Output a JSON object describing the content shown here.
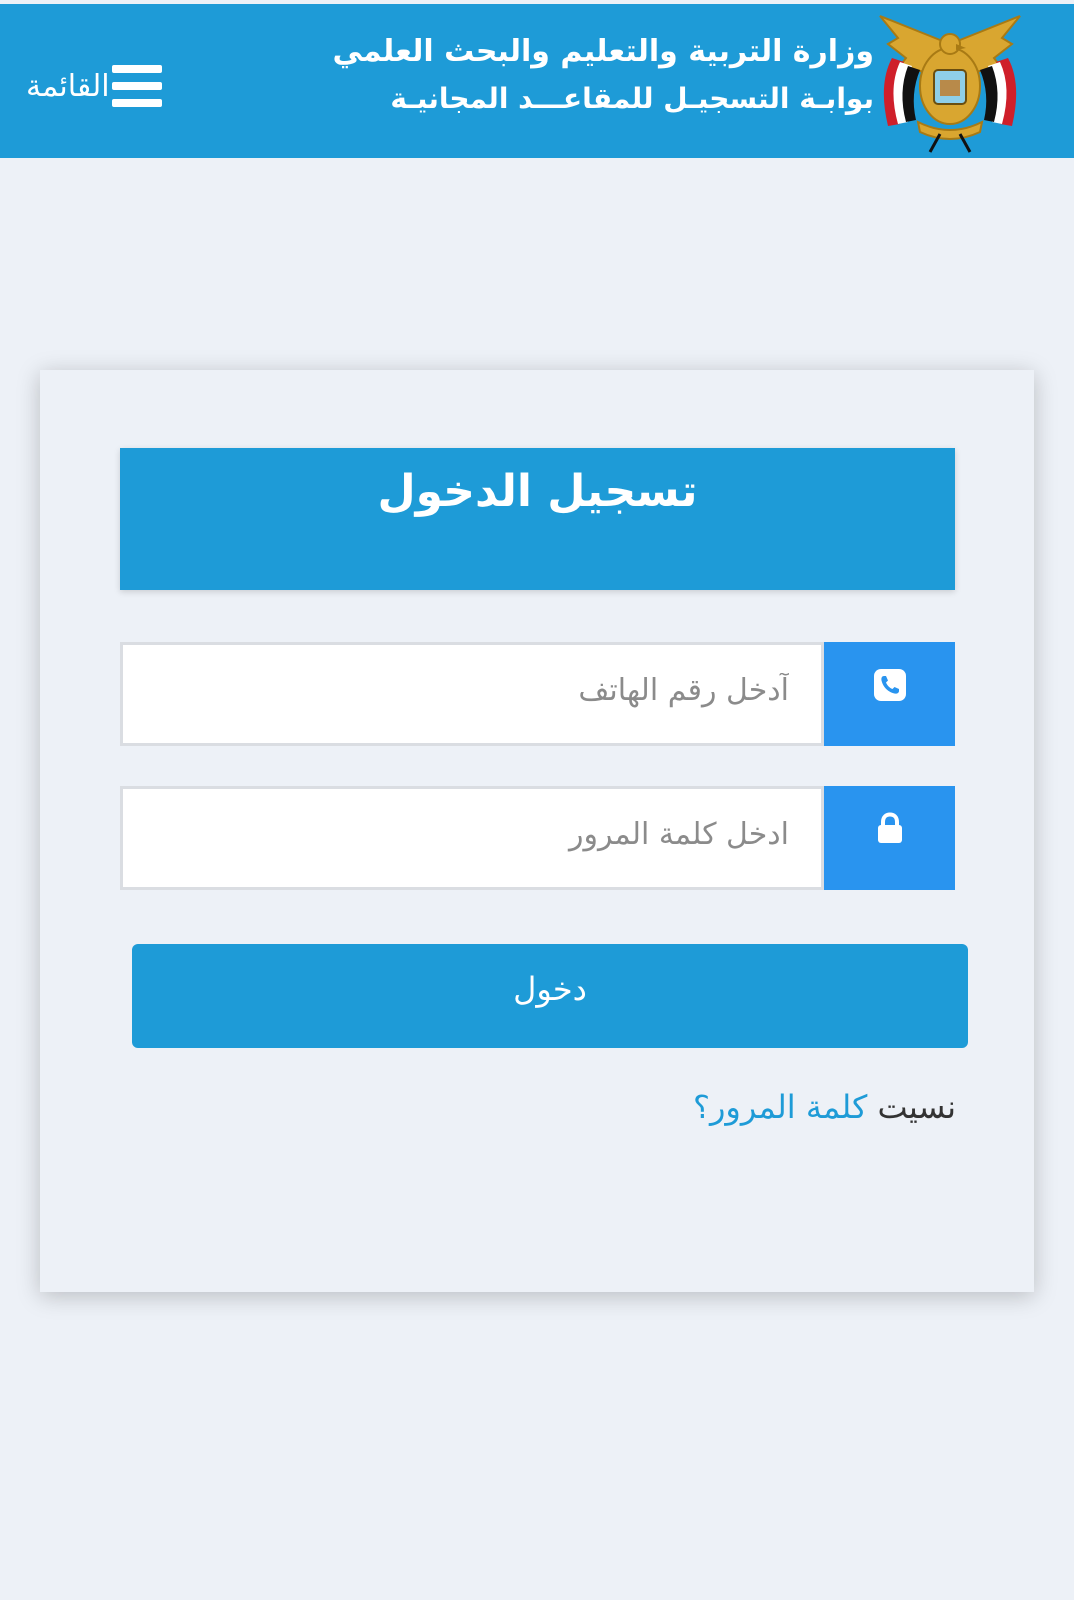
{
  "header": {
    "menu_label": "القائمة",
    "brand_line1": "وزارة التربية والتعليم والبحث العلمي",
    "brand_line2": "بوابـة التسجيـل للمقاعـــد المجانيـة",
    "background_color": "#1e9bd7"
  },
  "login": {
    "title": "تسجيل الدخول",
    "phone_placeholder": "آدخل رقم الهاتف",
    "phone_value": "",
    "phone_icon": "phone-icon",
    "password_placeholder": "ادخل كلمة المرور",
    "password_value": "",
    "password_icon": "lock-icon",
    "submit_label": "دخول",
    "forgot_prefix": "نسيت ",
    "forgot_link": "كلمة المرور؟",
    "accent_color": "#1e9bd7",
    "addon_color": "#2994ef"
  }
}
